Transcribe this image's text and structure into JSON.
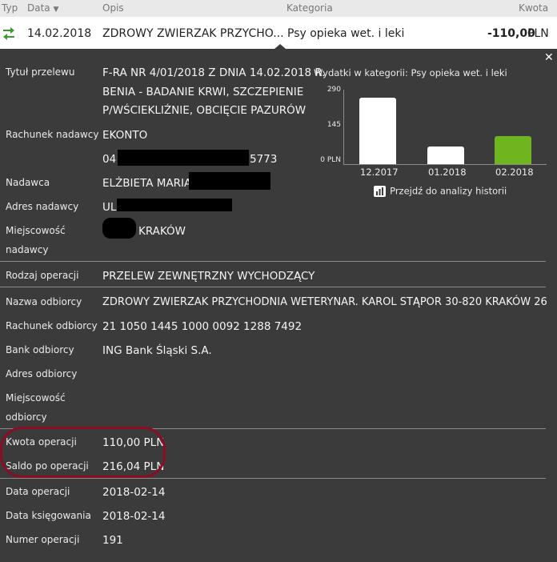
{
  "header": {
    "typ": "Typ",
    "data": "Data",
    "opis": "Opis",
    "kategoria": "Kategoria",
    "kwota": "Kwota"
  },
  "transaction": {
    "date": "14.02.2018",
    "description": "ZDROWY ZWIERZAK PRZYCHO...",
    "category": "Psy opieka wet. i leki",
    "amount": "-110,00",
    "currency": "PLN"
  },
  "details": {
    "title_label": "Tytuł przelewu",
    "title_lines": [
      "F-RA NR 4/01/2018 Z DNIA 14.02.2018 R.",
      "BENIA - BADANIE KRWI, SZCZEPIENIE",
      "P/WŚCIEKLIŹNIE, OBCIĘCIE PAZURÓW"
    ],
    "sender_account_label": "Rachunek nadawcy",
    "sender_account_name": "EKONTO",
    "sender_account_prefix": "04",
    "sender_account_suffix": "5773",
    "sender_label": "Nadawca",
    "sender_value": "ELŻBIETA MARIA M",
    "sender_address_label": "Adres nadawcy",
    "sender_address_value": "UL.",
    "sender_city_label_1": "Miejscowość",
    "sender_city_label_2": "nadawcy",
    "sender_city_value": "KRAKÓW",
    "operation_type_label": "Rodzaj operacji",
    "operation_type_value": "PRZELEW ZEWNĘTRZNY WYCHODZĄCY",
    "recipient_name_label": "Nazwa odbiorcy",
    "recipient_name_value": "ZDROWY ZWIERZAK PRZYCHODNIA WETERYNAR. KAROL STĄPOR 30-820 KRAKÓW 26",
    "recipient_account_label": "Rachunek odbiorcy",
    "recipient_account_value": "21 1050 1445 1000 0092 1288 7492",
    "recipient_bank_label": "Bank odbiorcy",
    "recipient_bank_value": "ING Bank Śląski S.A.",
    "recipient_address_label": "Adres odbiorcy",
    "recipient_city_label_1": "Miejscowość",
    "recipient_city_label_2": "odbiorcy",
    "amount_label": "Kwota operacji",
    "amount_value": "110,00 PLN",
    "balance_label": "Saldo po operacji",
    "balance_value": "216,04 PLN",
    "op_date_label": "Data operacji",
    "op_date_value": "2018-02-14",
    "booking_date_label": "Data księgowania",
    "booking_date_value": "2018-02-14",
    "op_number_label": "Numer operacji",
    "op_number_value": "191"
  },
  "chart": {
    "link": "Przejdź do analizy historii"
  },
  "chart_data": {
    "type": "bar",
    "title": "Wydatki w kategorii:  Psy opieka wet. i leki",
    "categories": [
      "12.2017",
      "01.2018",
      "02.2018"
    ],
    "values": [
      260,
      70,
      110
    ],
    "yticks": [
      "290",
      "145",
      "0 PLN"
    ],
    "ylim": [
      0,
      290
    ],
    "colors": [
      "#ffffff",
      "#ffffff",
      "#6fb51f"
    ]
  }
}
